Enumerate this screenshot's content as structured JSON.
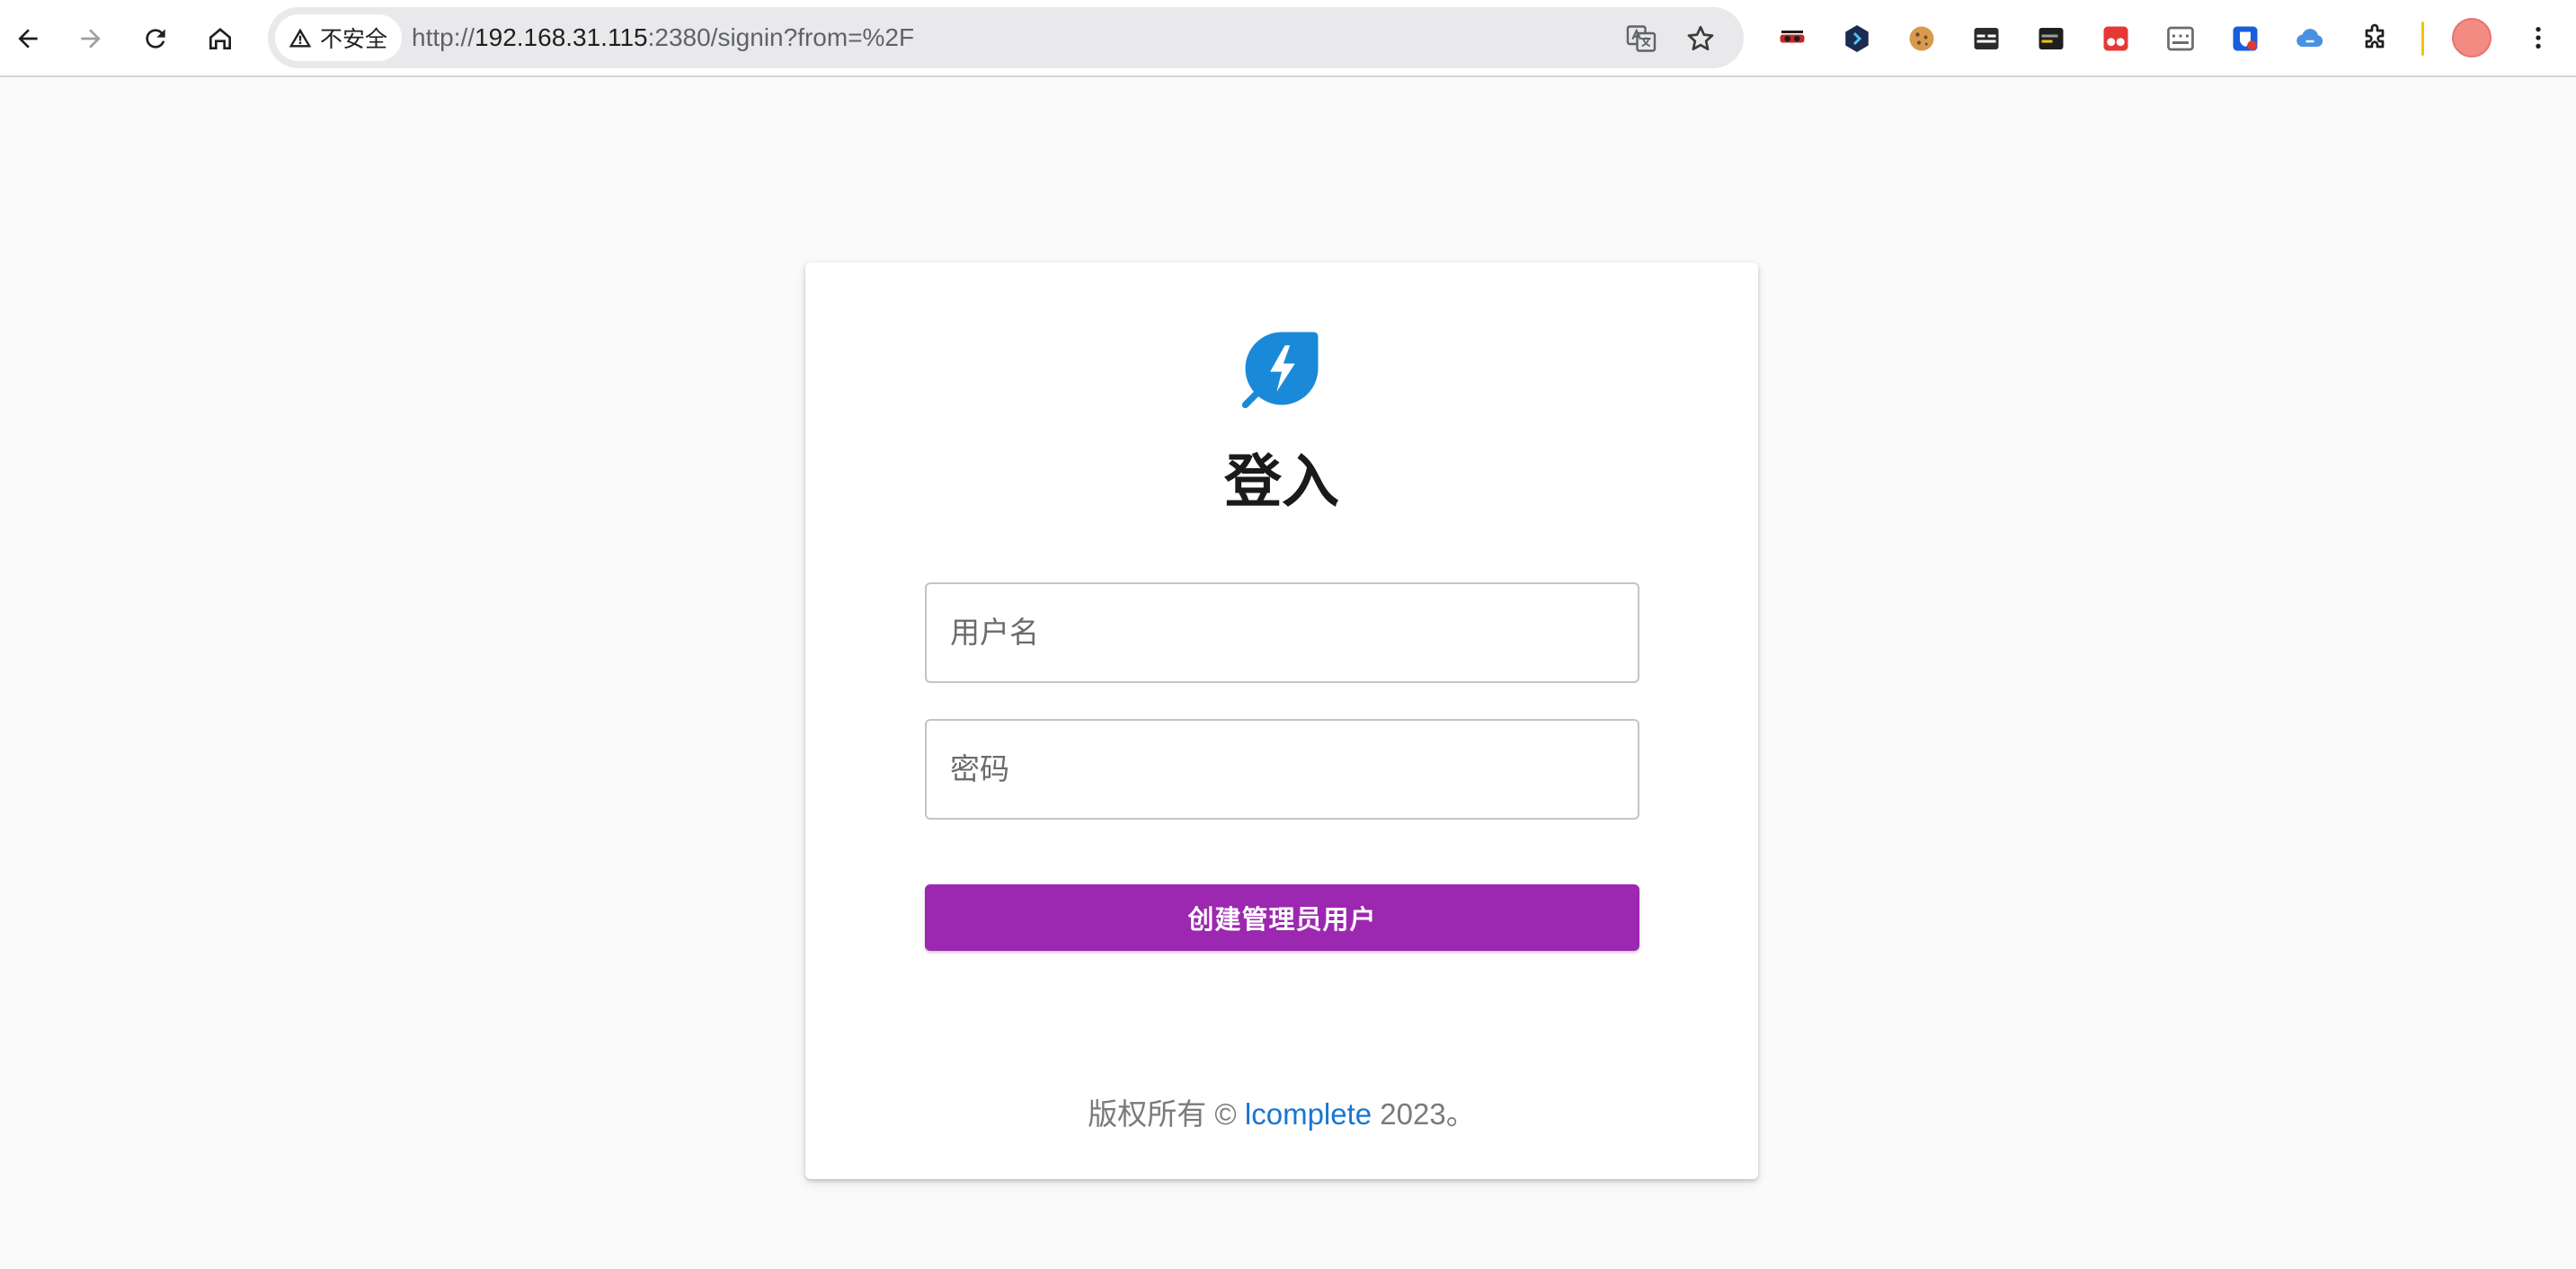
{
  "browser": {
    "security_label": "不安全",
    "url_scheme": "http://",
    "url_host": "192.168.31.115",
    "url_rest": ":2380/signin?from=%2F"
  },
  "login": {
    "title": "登入",
    "username_placeholder": "用户名",
    "password_placeholder": "密码",
    "submit_label": "创建管理员用户"
  },
  "footer": {
    "prefix": "版权所有 © ",
    "brand": "lcomplete",
    "suffix": " 2023。"
  },
  "colors": {
    "accent": "#9c27b0",
    "logo": "#1a8ad8",
    "link": "#1976d2"
  }
}
